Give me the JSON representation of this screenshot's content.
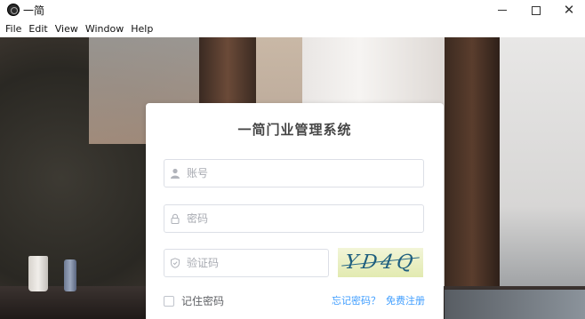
{
  "window": {
    "title": "一简",
    "controls": {
      "minimize": "—",
      "maximize": "☐",
      "close": "✕"
    }
  },
  "menu": [
    "File",
    "Edit",
    "View",
    "Window",
    "Help"
  ],
  "login": {
    "title": "一简门业管理系统",
    "username_placeholder": "账号",
    "username_value": "",
    "password_placeholder": "密码",
    "password_value": "",
    "captcha_placeholder": "验证码",
    "captcha_value": "",
    "captcha_image_text": "YD4Q",
    "remember_label": "记住密码",
    "remember_checked": false,
    "forgot_link": "忘记密码？",
    "register_link": "免费注册",
    "link_color": "#409eff"
  },
  "icons": {
    "username": "user-icon",
    "password": "lock-icon",
    "captcha": "shield-check-icon"
  }
}
